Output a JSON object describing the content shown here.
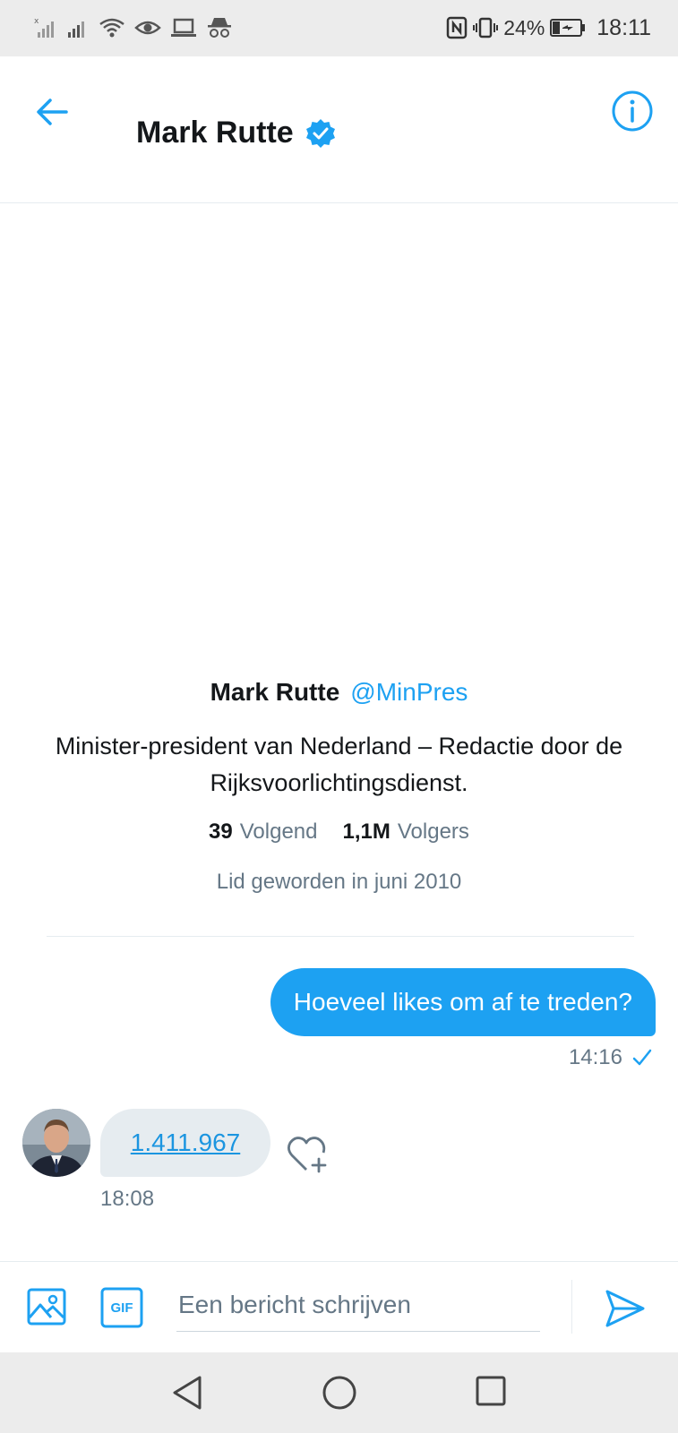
{
  "status_bar": {
    "battery_percent": "24%",
    "time": "18:11",
    "icons_left": [
      "no-signal-icon",
      "signal-icon",
      "wifi-icon",
      "eye-icon",
      "laptop-icon",
      "incognito-icon"
    ],
    "icons_right": [
      "nfc-icon",
      "vibrate-icon",
      "battery-charging-icon"
    ]
  },
  "header": {
    "title": "Mark Rutte",
    "verified": true,
    "back_icon": "back-arrow-icon",
    "info_icon": "info-icon"
  },
  "profile": {
    "name": "Mark Rutte",
    "handle": "@MinPres",
    "bio": "Minister-president van Nederland – Redactie door de Rijksvoorlichtingsdienst.",
    "following_count": "39",
    "following_label": "Volgend",
    "followers_count": "1,1M",
    "followers_label": "Volgers",
    "joined": "Lid geworden in juni 2010"
  },
  "messages": [
    {
      "direction": "sent",
      "text": "Hoeveel likes om af te treden?",
      "time": "14:16",
      "status": "sent-check"
    },
    {
      "direction": "received",
      "text": "1.411.967",
      "time": "18:08",
      "is_link": true
    }
  ],
  "composer": {
    "placeholder": "Een bericht schrijven",
    "value": "",
    "media_icon": "image-icon",
    "gif_label": "GIF",
    "send_icon": "send-icon"
  },
  "colors": {
    "accent": "#1da1f2",
    "link": "#1b95e0",
    "secondary_text": "#657786",
    "bubble_received": "#e6ecf0"
  }
}
